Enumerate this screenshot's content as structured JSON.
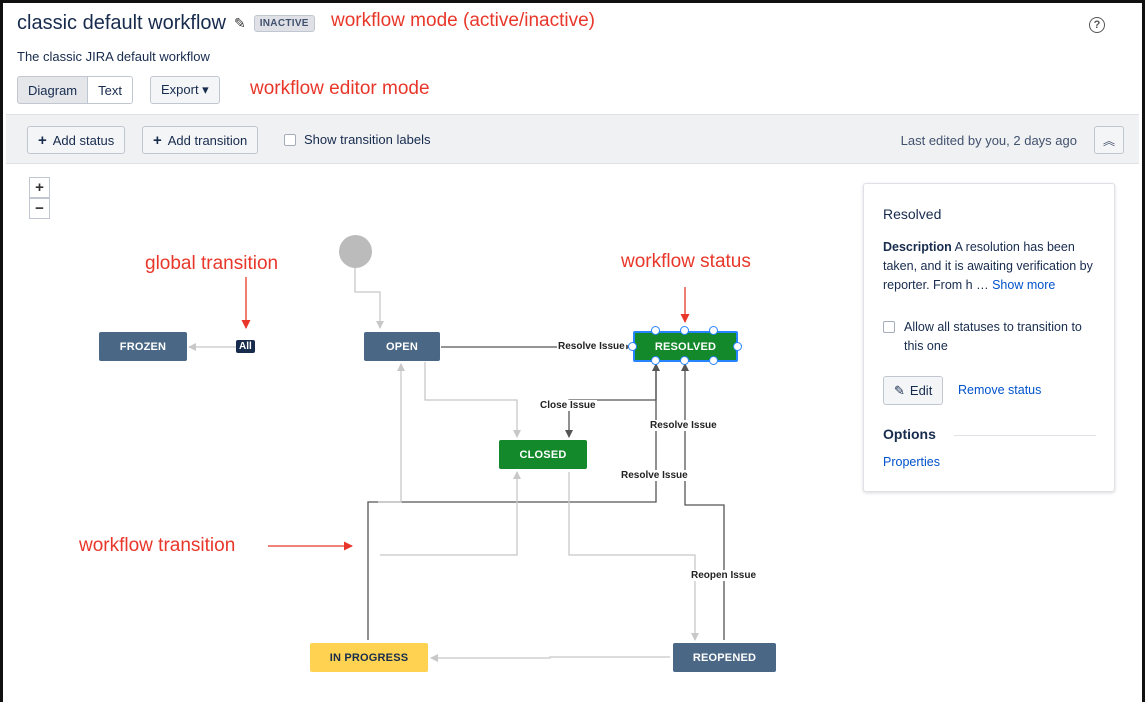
{
  "header": {
    "title": "classic default workflow",
    "status_badge": "INACTIVE",
    "description": "The classic JIRA default workflow",
    "help_icon": "question-circle-icon"
  },
  "annotations": {
    "workflow_mode": "workflow mode (active/inactive)",
    "editor_mode": "workflow editor mode",
    "global_transition": "global transition",
    "workflow_status": "workflow status",
    "workflow_transition": "workflow transition"
  },
  "view_toggle": {
    "diagram": "Diagram",
    "text": "Text"
  },
  "export_label": "Export ▾",
  "toolbar": {
    "add_status": "Add status",
    "add_transition": "Add transition",
    "show_labels": "Show transition labels",
    "last_edited": "Last edited by you, 2 days ago"
  },
  "zoom": {
    "in": "+",
    "out": "−"
  },
  "statuses": {
    "frozen": "FROZEN",
    "open": "OPEN",
    "resolved": "RESOLVED",
    "closed": "CLOSED",
    "in_progress": "IN PROGRESS",
    "reopened": "REOPENED"
  },
  "transitions": {
    "all": "All",
    "resolve_issue": "Resolve Issue",
    "close_issue": "Close Issue",
    "reopen_issue": "Reopen Issue"
  },
  "colors": {
    "annotation": "#e8372a",
    "status_todo": "#4a6785",
    "status_done": "#14892c",
    "status_inprogress": "#ffd351",
    "selection": "#2684ff",
    "link": "#0052cc"
  },
  "panel": {
    "title": "Resolved",
    "description_label": "Description",
    "description_text": "A resolution has been taken, and it is awaiting verification by reporter. From h",
    "ellipsis": "…",
    "show_more": "Show more",
    "allow_all": "Allow all statuses to transition to this one",
    "edit": "Edit",
    "remove_status": "Remove status",
    "options_heading": "Options",
    "properties": "Properties"
  }
}
